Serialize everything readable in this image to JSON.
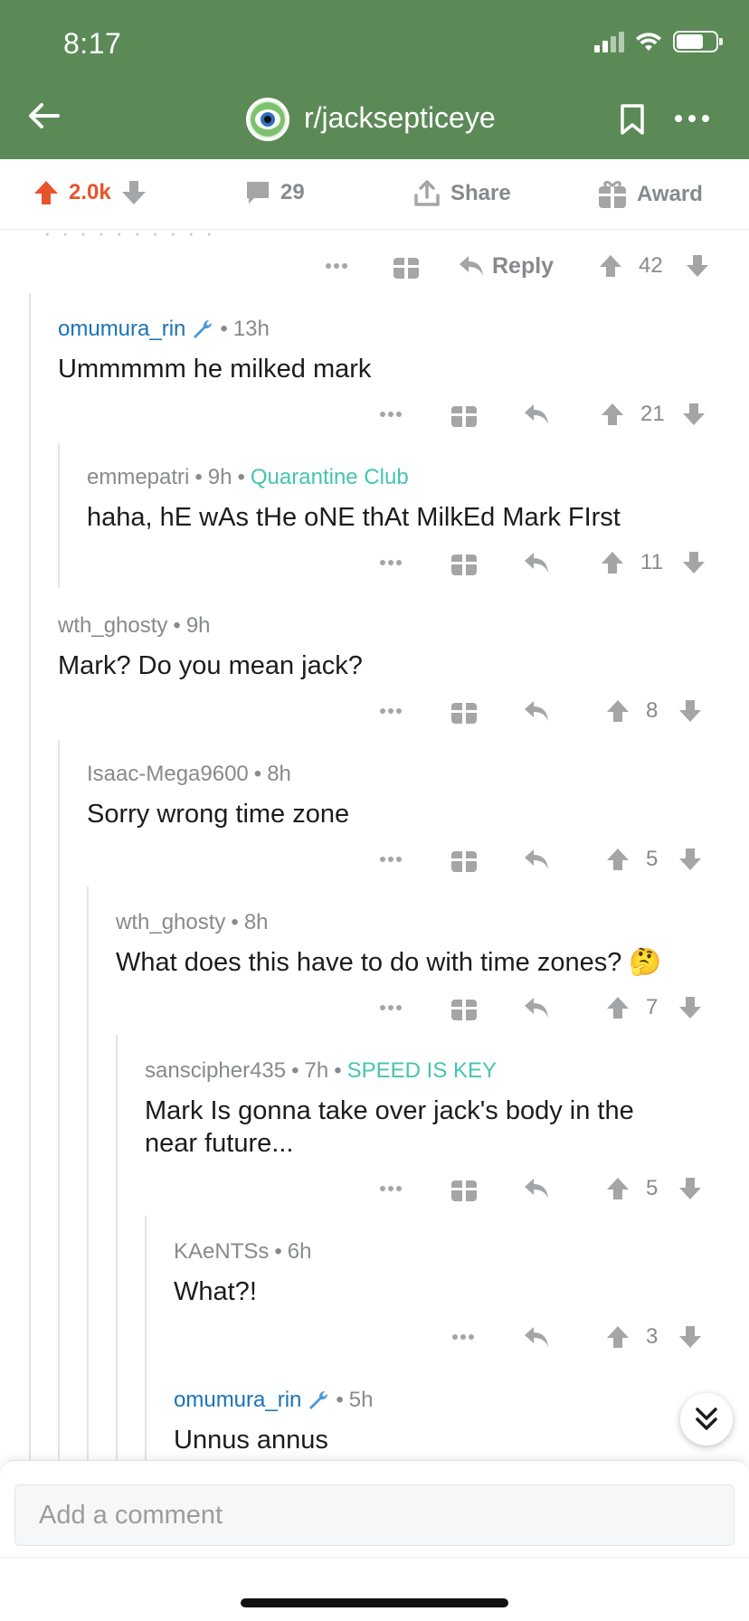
{
  "status": {
    "time": "8:17"
  },
  "nav": {
    "subreddit": "r/jacksepticeye"
  },
  "post_bar": {
    "upvotes": "2.0k",
    "comments": "29",
    "share_label": "Share",
    "award_label": "Award"
  },
  "top_actions": {
    "reply_label": "Reply",
    "score": "42"
  },
  "comments": [
    {
      "user": "omumura_rin",
      "sep": "•",
      "time": "13h",
      "flair": "",
      "body": "Ummmmm he milked mark",
      "score": "21"
    },
    {
      "user": "emmepatri",
      "sep": "•",
      "time": "9h",
      "flair": "Quarantine Club",
      "body": "haha, hE wAs tHe oNE thAt MilkEd Mark FIrst",
      "score": "11"
    },
    {
      "user": "wth_ghosty",
      "sep": "•",
      "time": "9h",
      "flair": "",
      "body": "Mark? Do you mean jack?",
      "score": "8"
    },
    {
      "user": "Isaac-Mega9600",
      "sep": "•",
      "time": "8h",
      "flair": "",
      "body": "Sorry wrong time zone",
      "score": "5"
    },
    {
      "user": "wth_ghosty",
      "sep": "•",
      "time": "8h",
      "flair": "",
      "body": "What does this have to do with time zones? 🤔",
      "score": "7"
    },
    {
      "user": "sanscipher435",
      "sep": "•",
      "time": "7h",
      "flair": "SPEED IS KEY",
      "body": "Mark Is gonna take over jack's body in the near future...",
      "score": "5"
    },
    {
      "user": "KAeNTSs",
      "sep": "•",
      "time": "6h",
      "flair": "",
      "body": "What?!",
      "score": "3"
    },
    {
      "user": "omumura_rin",
      "sep": "•",
      "time": "5h",
      "flair": "",
      "body": "Unnus annus",
      "score": ""
    }
  ],
  "composer": {
    "placeholder": "Add a comment"
  },
  "colors": {
    "header": "#5c8a57",
    "upvote": "#e8542a",
    "op_user": "#1a73b8",
    "flair": "#46c4b0"
  }
}
